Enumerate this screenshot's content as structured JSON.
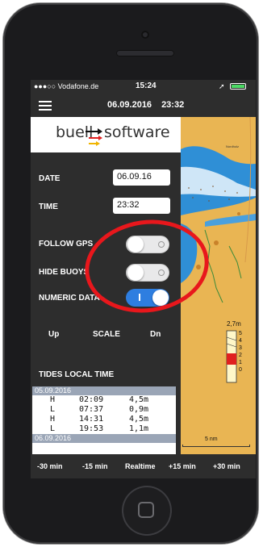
{
  "status_bar": {
    "carrier": "●●●○○ Vodafone.de",
    "time": "15:24"
  },
  "nav": {
    "date": "06.09.2016",
    "time": "23:32"
  },
  "logo": {
    "left": "buell",
    "right": "software"
  },
  "form": {
    "date_label": "DATE",
    "date_value": "06.09.16",
    "time_label": "TIME",
    "time_value": "23:32"
  },
  "toggles": {
    "follow_gps": {
      "label": "FOLLOW GPS",
      "on": false
    },
    "hide_buoys": {
      "label": "HIDE BUOYS",
      "on": false
    },
    "numeric_data": {
      "label": "NUMERIC DATA",
      "on": true
    }
  },
  "scale": {
    "up": "Up",
    "label": "SCALE",
    "dn": "Dn"
  },
  "tides": {
    "title": "TIDES LOCAL TIME",
    "day1": "05.09.2016",
    "rows": [
      {
        "type": "H",
        "time": "02:09",
        "height": "4,5m"
      },
      {
        "type": "L",
        "time": "07:37",
        "height": "0,9m"
      },
      {
        "type": "H",
        "time": "14:31",
        "height": "4,5m"
      },
      {
        "type": "L",
        "time": "19:53",
        "height": "1,1m"
      }
    ],
    "day2": "06.09.2016"
  },
  "map": {
    "gauge_value": "2,7m",
    "gauge_ticks": [
      "5",
      "4",
      "3",
      "2",
      "1",
      "0"
    ],
    "scale_text": "5 nm",
    "colors": {
      "land": "#e9b553",
      "water": "#2f8fd6"
    }
  },
  "bottom_bar": {
    "minus30": "-30 min",
    "minus15": "-15 min",
    "realtime": "Realtime",
    "plus15": "+15 min",
    "plus30": "+30 min"
  }
}
